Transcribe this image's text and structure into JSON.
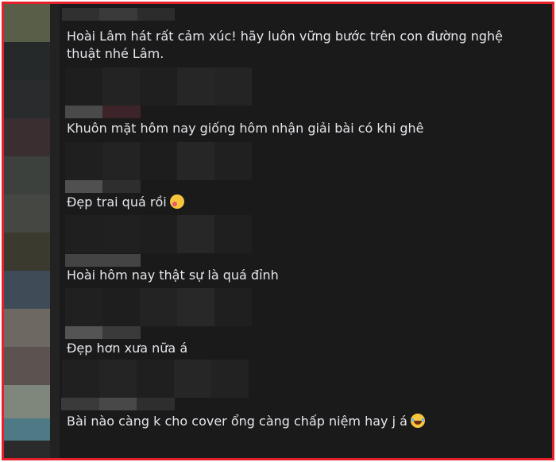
{
  "comments": [
    {
      "text": "Hoài Lâm hát rất cảm xúc! hãy luôn vững bước trên con đường nghệ thuật nhé Lâm.",
      "emoji": ""
    },
    {
      "text": "Khuôn mặt hôm nay giống hôm nhận giải bài có khi ghê",
      "emoji": ""
    },
    {
      "text": "Đẹp trai quá rồi",
      "emoji": "smiling-face-with-hearts-emoji"
    },
    {
      "text": "Hoài hôm nay thật sự là quá đỉnh",
      "emoji": ""
    },
    {
      "text": "Đẹp hơn xưa nữa á",
      "emoji": ""
    },
    {
      "text": "Bài nào càng k cho cover ổng càng chấp niệm hay j á",
      "emoji": "laughing-with-tears-emoji"
    }
  ],
  "colors": {
    "frame_border": "#e5202a",
    "background": "#1a1a1a",
    "comment_text": "#e4e6eb"
  }
}
